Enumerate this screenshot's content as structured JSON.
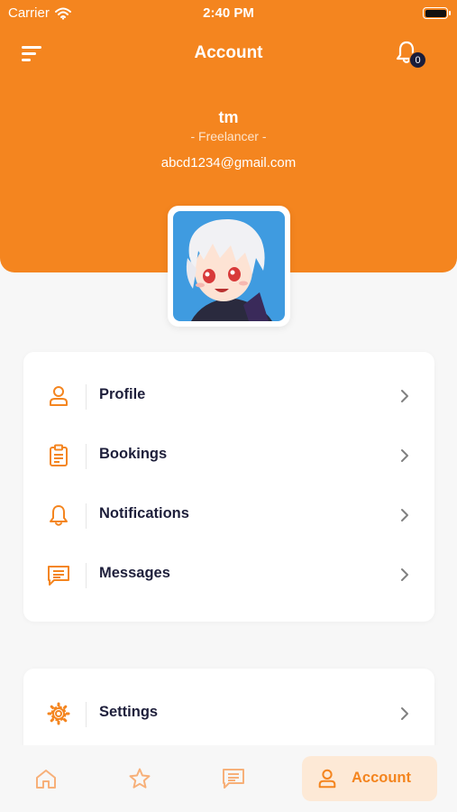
{
  "status_bar": {
    "carrier": "Carrier",
    "time": "2:40 PM"
  },
  "header": {
    "title": "Account",
    "notification_count": "0",
    "user": {
      "name": "tm",
      "role": "- Freelancer -",
      "email": "abcd1234@gmail.com"
    }
  },
  "menu": {
    "items": [
      {
        "label": "Profile",
        "icon": "person-icon"
      },
      {
        "label": "Bookings",
        "icon": "clipboard-icon"
      },
      {
        "label": "Notifications",
        "icon": "bell-icon"
      },
      {
        "label": "Messages",
        "icon": "message-icon"
      }
    ]
  },
  "settings": {
    "items": [
      {
        "label": "Settings",
        "icon": "gear-icon"
      }
    ]
  },
  "tabbar": {
    "tabs": [
      {
        "icon": "home-icon"
      },
      {
        "icon": "star-icon"
      },
      {
        "icon": "chat-icon"
      },
      {
        "label": "Account",
        "icon": "person-icon",
        "active": true
      }
    ]
  },
  "colors": {
    "accent": "#f4851f",
    "dark": "#1e1f3b",
    "background": "#f7f7f7"
  }
}
